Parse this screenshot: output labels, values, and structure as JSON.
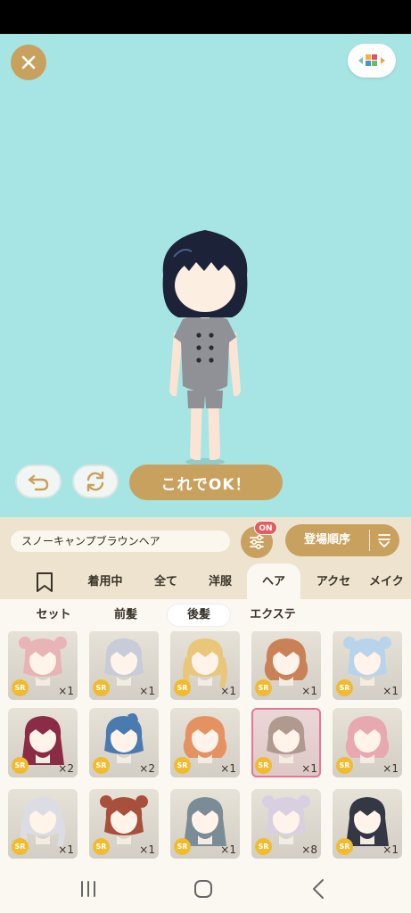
{
  "stage": {
    "ok_label": "これでOK！",
    "background": "#a6e5e3"
  },
  "controls": {
    "item_name": "スノーキャンプブラウンヘア",
    "filter_badge": "ON",
    "sort_label": "登場順序"
  },
  "category_tabs": [
    {
      "label": "着用中"
    },
    {
      "label": "全て"
    },
    {
      "label": "洋服"
    },
    {
      "label": "ヘア",
      "active": true
    },
    {
      "label": "アクセ"
    },
    {
      "label": "メイク"
    }
  ],
  "sub_tabs": [
    {
      "label": "セット"
    },
    {
      "label": "前髪"
    },
    {
      "label": "後髪",
      "active": true
    },
    {
      "label": "エクステ"
    }
  ],
  "items": [
    {
      "rarity": "SR",
      "count": "×1",
      "hair_color": "#e8b4b6",
      "style": "bows"
    },
    {
      "rarity": "SR",
      "count": "×1",
      "hair_color": "#c8ccd8",
      "style": "short"
    },
    {
      "rarity": "SR",
      "count": "×1",
      "hair_color": "#e8c67a",
      "style": "twintail"
    },
    {
      "rarity": "SR",
      "count": "×1",
      "hair_color": "#c98258",
      "style": "wavy"
    },
    {
      "rarity": "SR",
      "count": "×1",
      "hair_color": "#b8d4ea",
      "style": "buns"
    },
    {
      "rarity": "SR",
      "count": "×2",
      "hair_color": "#8a2c46",
      "style": "long-side"
    },
    {
      "rarity": "SR",
      "count": "×2",
      "hair_color": "#4a7bb0",
      "style": "ponytail"
    },
    {
      "rarity": "SR",
      "count": "×1",
      "hair_color": "#e49262",
      "style": "curly"
    },
    {
      "rarity": "SR",
      "count": "×1",
      "hair_color": "#b09a90",
      "style": "bob",
      "selected": true
    },
    {
      "rarity": "SR",
      "count": "×1",
      "hair_color": "#e8a8b0",
      "style": "fluffy"
    },
    {
      "rarity": "SR",
      "count": "×1",
      "hair_color": "#dcdde4",
      "style": "braids"
    },
    {
      "rarity": "SR",
      "count": "×1",
      "hair_color": "#a8503c",
      "style": "bear-buns"
    },
    {
      "rarity": "SR",
      "count": "×1",
      "hair_color": "#7a8c96",
      "style": "long-wavy"
    },
    {
      "rarity": "SR",
      "count": "×8",
      "hair_color": "#d8d0e0",
      "style": "horns"
    },
    {
      "rarity": "SR",
      "count": "×1",
      "hair_color": "#343845",
      "style": "long-straight"
    }
  ],
  "icons": {
    "close": "close-icon",
    "palette": "palette-icon",
    "undo": "undo-icon",
    "rotate": "rotate-icon",
    "filter": "sliders-icon",
    "sort": "sort-icon",
    "bookmark": "bookmark-icon"
  },
  "colors": {
    "accent": "#c9a15e",
    "badge": "#e85a5e",
    "rarity": "#f1bb2e",
    "selected_border": "#e0789a"
  }
}
